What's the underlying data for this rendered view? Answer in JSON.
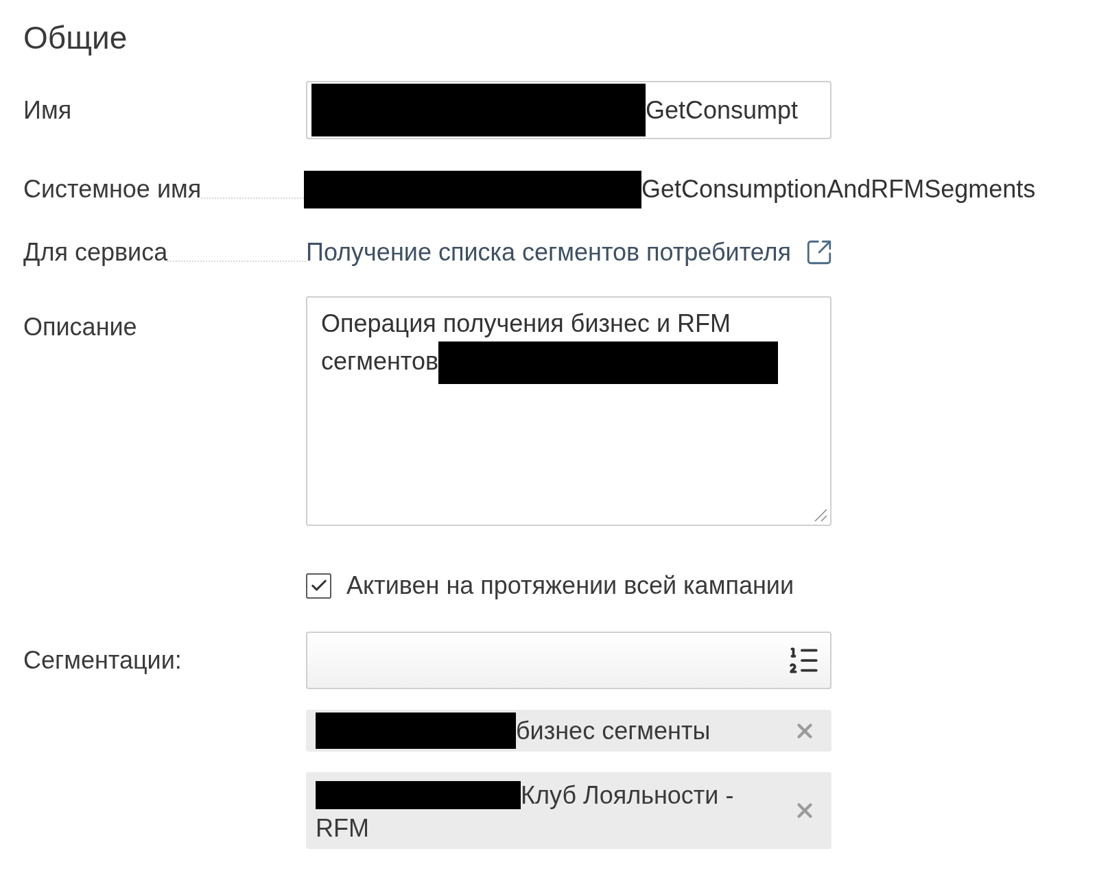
{
  "title": "Общие",
  "name": {
    "label": "Имя",
    "value": "GetConsumpt",
    "redacted": true
  },
  "system_name": {
    "label": "Системное имя",
    "value": "GetConsumptionAndRFMSegments",
    "redacted": true
  },
  "service": {
    "label": "Для сервиса",
    "link": "Получение списка сегментов потребителя"
  },
  "description": {
    "label": "Описание",
    "value": "Операция получения бизнес и RFM сегментов",
    "redacted": true
  },
  "active_whole_campaign": {
    "label": "Активен на протяжении всей кампании",
    "checked": true
  },
  "segmentations": {
    "label": "Сегментации:",
    "tags": [
      {
        "text": "бизнес сегменты",
        "redacted": true
      },
      {
        "text": "Клуб Лояльности - RFM",
        "redacted": true
      }
    ]
  }
}
